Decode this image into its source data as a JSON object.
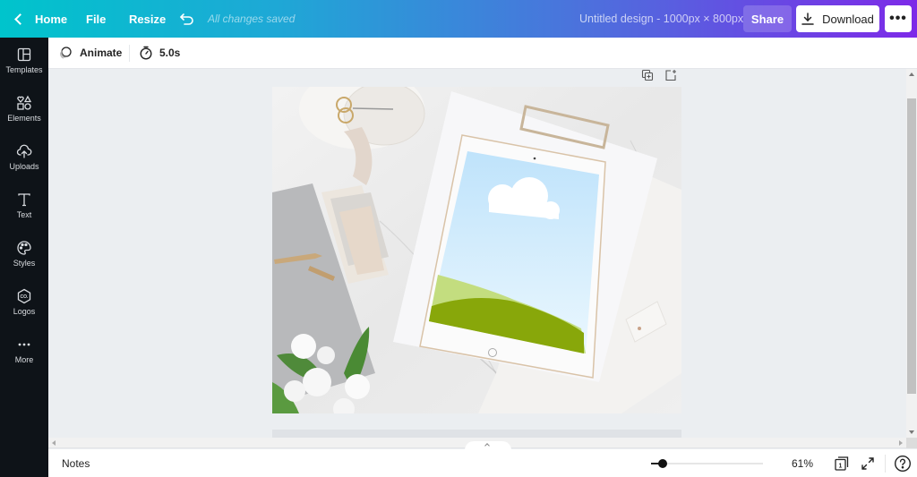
{
  "topbar": {
    "home_label": "Home",
    "file_label": "File",
    "resize_label": "Resize",
    "save_status": "All changes saved",
    "design_title": "Untitled design - 1000px × 800px",
    "share_label": "Share",
    "download_label": "Download",
    "more_label": "•••"
  },
  "sidebar": {
    "items": [
      {
        "label": "Templates",
        "icon": "templates-icon"
      },
      {
        "label": "Elements",
        "icon": "elements-icon"
      },
      {
        "label": "Uploads",
        "icon": "upload-cloud-icon"
      },
      {
        "label": "Text",
        "icon": "text-icon"
      },
      {
        "label": "Styles",
        "icon": "palette-icon"
      },
      {
        "label": "Logos",
        "icon": "logo-badge-icon"
      },
      {
        "label": "More",
        "icon": "more-dots-icon"
      }
    ]
  },
  "toolbar": {
    "animate_label": "Animate",
    "duration": "5.0s"
  },
  "canvas": {
    "image_description": "Flat-lay photo: white tablet with sky, cloud and green hills on screen, clipboard, notebook, pen, scissors and white flowers on marble",
    "colors": {
      "sky_top": "#bfe3fb",
      "sky_bottom": "#eaf7fe",
      "hill_light": "#c3dd7f",
      "hill_dark": "#88a70a",
      "marble": "#eeeeee"
    }
  },
  "bottombar": {
    "notes_label": "Notes",
    "zoom_percent": "61%",
    "zoom_value": 0.1,
    "page_count": "1"
  },
  "colors": {
    "gradient_start": "#00c4cc",
    "gradient_end": "#7d2ae8",
    "sidebar_bg": "#0e1318",
    "canvas_bg": "#ebeef1"
  }
}
